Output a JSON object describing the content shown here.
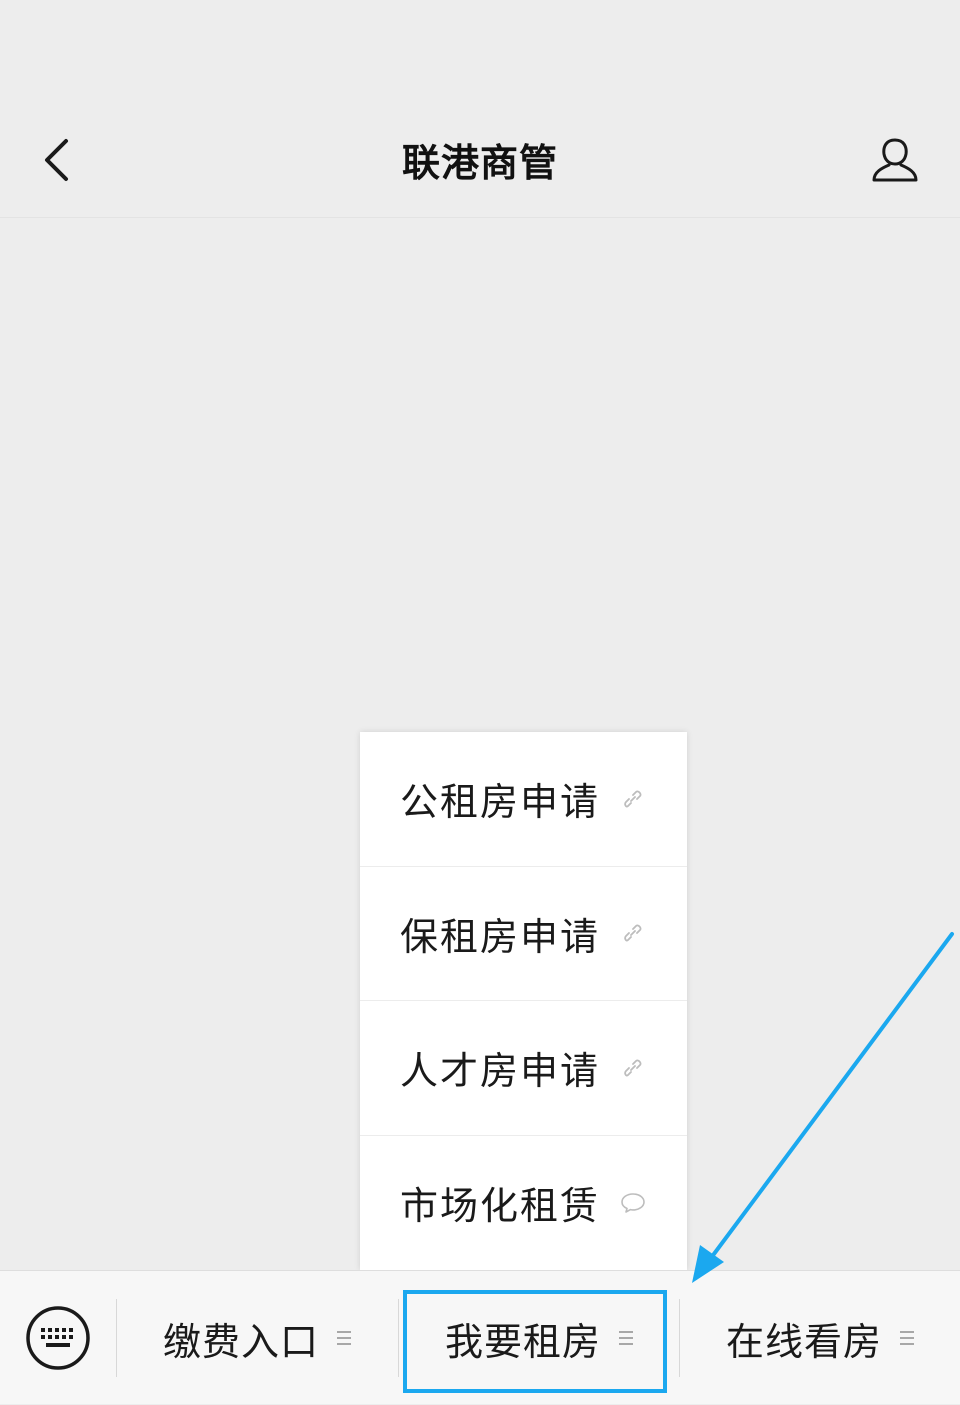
{
  "nav": {
    "title": "联港商管",
    "back_icon": "chevron-left-icon",
    "profile_icon": "person-icon"
  },
  "submenu": {
    "items": [
      {
        "label": "公租房申请",
        "icon": "link-icon"
      },
      {
        "label": "保租房申请",
        "icon": "link-icon"
      },
      {
        "label": "人才房申请",
        "icon": "link-icon"
      },
      {
        "label": "市场化租赁",
        "icon": "chat-bubble-icon"
      }
    ]
  },
  "bottom_menu": {
    "keyboard_icon": "keyboard-icon",
    "items": [
      {
        "label": "缴费入口",
        "icon": "menu-lines-icon"
      },
      {
        "label": "我要租房",
        "icon": "menu-lines-icon",
        "highlighted": true
      },
      {
        "label": "在线看房",
        "icon": "menu-lines-icon"
      }
    ]
  },
  "colors": {
    "background": "#ededed",
    "highlight": "#1ba8ef",
    "text": "#1a1a1a"
  }
}
